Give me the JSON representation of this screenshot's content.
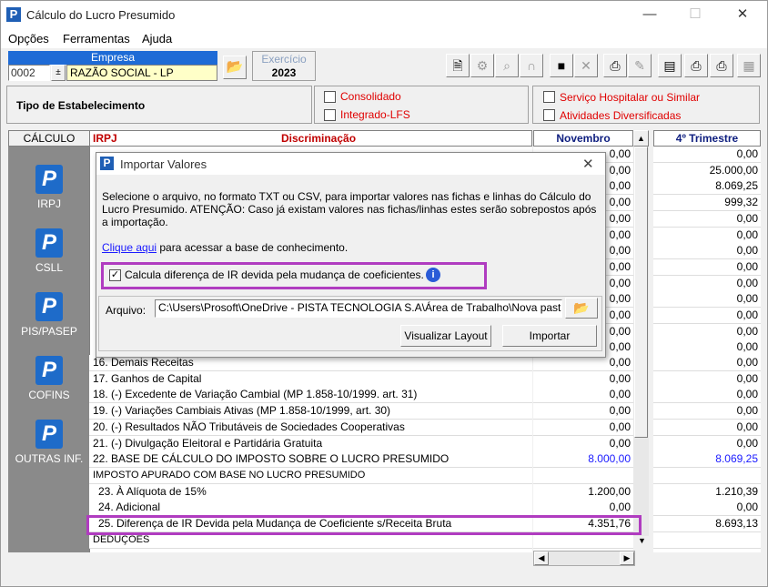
{
  "window": {
    "title": "Cálculo do Lucro Presumido",
    "minimize": "—",
    "maximize": "☐",
    "close": "✕"
  },
  "menu": [
    "Opções",
    "Ferramentas",
    "Ajuda"
  ],
  "empresa": {
    "label": "Empresa",
    "code": "0002",
    "name": "RAZÃO SOCIAL - LP"
  },
  "exercicio": {
    "label": "Exercício",
    "year": "2023"
  },
  "tipo_estabelecimento": "Tipo de Estabelecimento",
  "options": {
    "consolidado": "Consolidado",
    "integrado": "Integrado-LFS",
    "hospitalar": "Serviço Hospitalar ou Similar",
    "diversificadas": "Atividades Diversificadas"
  },
  "sidebar": {
    "header": "CÁLCULO",
    "items": [
      "IRPJ",
      "CSLL",
      "PIS/PASEP",
      "COFINS",
      "OUTRAS INF."
    ]
  },
  "table": {
    "col_irpj": "IRPJ",
    "col_disc": "Discriminação",
    "col_nov": "Novembro",
    "col_tri": "4º Trimestre",
    "top_nov": [
      "0,00",
      "0,00",
      "0,00",
      "0,00",
      "0,00",
      "0,00",
      "0,00",
      "0,00",
      "0,00",
      "0,00",
      "0,00",
      "0,00",
      "0,00"
    ],
    "top_tri": [
      "0,00",
      "25.000,00",
      "8.069,25",
      "999,32",
      "0,00",
      "0,00",
      "0,00",
      "0,00",
      "0,00",
      "0,00",
      "0,00",
      "0,00",
      "0,00"
    ],
    "rows": [
      {
        "label": "16. Demais Receitas",
        "nov": "0,00",
        "tri": "0,00"
      },
      {
        "label": "17. Ganhos de Capital",
        "nov": "0,00",
        "tri": "0,00"
      },
      {
        "label": "18. (-) Excedente de Variação Cambial (MP 1.858-10/1999. art. 31)",
        "nov": "0,00",
        "tri": "0,00"
      },
      {
        "label": "19. (-) Variações Cambiais Ativas (MP 1.858-10/1999, art. 30)",
        "nov": "0,00",
        "tri": "0,00"
      },
      {
        "label": "20. (-) Resultados NÃO Tributáveis de Sociedades Cooperativas",
        "nov": "0,00",
        "tri": "0,00"
      },
      {
        "label": "21. (-) Divulgação Eleitoral e Partidária Gratuita",
        "nov": "0,00",
        "tri": "0,00"
      },
      {
        "label": "22. BASE DE CÁLCULO DO IMPOSTO SOBRE O LUCRO PRESUMIDO",
        "nov": "8.000,00",
        "tri": "8.069,25"
      },
      {
        "label": "IMPOSTO APURADO COM BASE NO LUCRO PRESUMIDO",
        "nov": "",
        "tri": ""
      },
      {
        "label": "23. À Alíquota de 15%",
        "nov": "1.200,00",
        "tri": "1.210,39"
      },
      {
        "label": "24. Adicional",
        "nov": "0,00",
        "tri": "0,00"
      },
      {
        "label": "25. Diferença de IR Devida pela Mudança de Coeficiente s/Receita Bruta",
        "nov": "4.351,76",
        "tri": "8.693,13"
      },
      {
        "label": "DEDUÇÕES",
        "nov": "",
        "tri": ""
      }
    ]
  },
  "dialog": {
    "title": "Importar Valores",
    "text": "Selecione o arquivo, no formato TXT ou CSV, para importar valores nas fichas e linhas do Cálculo do Lucro Presumido. ATENÇÃO: Caso já existam valores nas fichas/linhas estes serão sobrepostos após a importação.",
    "link": "Clique aqui",
    "link_suffix": " para acessar a base de conhecimento.",
    "checkbox": "Calcula diferença de IR devida pela mudança de coeficientes.",
    "arquivo_label": "Arquivo:",
    "arquivo_value": "C:\\Users\\Prosoft\\OneDrive - PISTA TECNOLOGIA S.A\\Área de Trabalho\\Nova pasta",
    "btn_layout": "Visualizar Layout",
    "btn_import": "Importar"
  },
  "colors": {
    "accent_blue": "#1e6bc9",
    "highlight_purple": "#b03cc0",
    "red_text": "#e00000",
    "link_blue": "#1a1aff"
  }
}
